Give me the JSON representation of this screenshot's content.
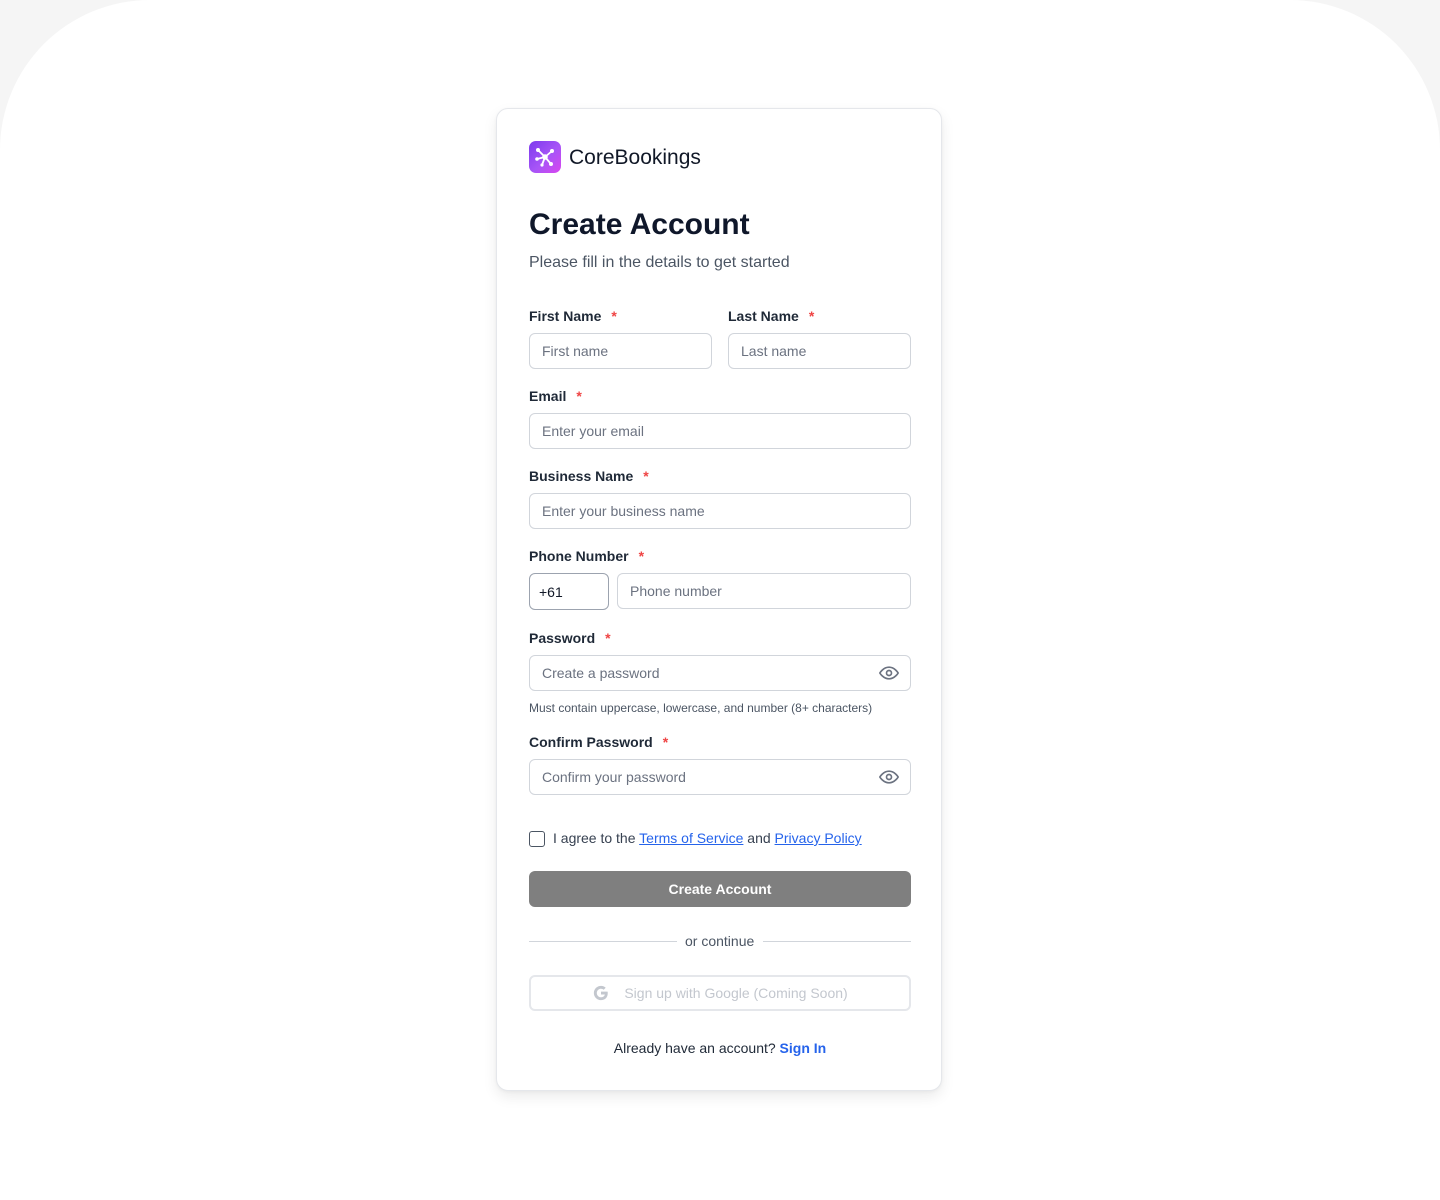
{
  "brand": {
    "name": "CoreBookings",
    "logo_icon": "network-nodes-icon",
    "logo_colors": [
      "#7c3aed",
      "#d946ef"
    ]
  },
  "header": {
    "title": "Create Account",
    "subtitle": "Please fill in the details to get started"
  },
  "form": {
    "required_marker": "*",
    "first_name": {
      "label": "First Name",
      "placeholder": "First name",
      "value": ""
    },
    "last_name": {
      "label": "Last Name",
      "placeholder": "Last name",
      "value": ""
    },
    "email": {
      "label": "Email",
      "placeholder": "Enter your email",
      "value": ""
    },
    "business_name": {
      "label": "Business Name",
      "placeholder": "Enter your business name",
      "value": ""
    },
    "phone": {
      "label": "Phone Number",
      "country_code": "+61",
      "placeholder": "Phone number",
      "value": ""
    },
    "password": {
      "label": "Password",
      "placeholder": "Create a password",
      "hint": "Must contain uppercase, lowercase, and number (8+ characters)",
      "toggle_icon": "eye-icon"
    },
    "confirm_password": {
      "label": "Confirm Password",
      "placeholder": "Confirm your password",
      "toggle_icon": "eye-icon"
    },
    "terms": {
      "checked": false,
      "prefix": "I agree to the",
      "terms_link": "Terms of Service",
      "conjunction": "and",
      "privacy_link": "Privacy Policy"
    },
    "submit_label": "Create Account"
  },
  "divider": {
    "text": "or continue"
  },
  "google": {
    "label": "Sign up with Google (Coming Soon)",
    "icon": "google-icon"
  },
  "footer": {
    "prompt": "Already have an account?",
    "signin_label": "Sign In"
  },
  "colors": {
    "accent": "#2563eb",
    "required": "#ef4444",
    "submit_disabled": "#7f7f7f",
    "background": "#f5f5f5"
  }
}
